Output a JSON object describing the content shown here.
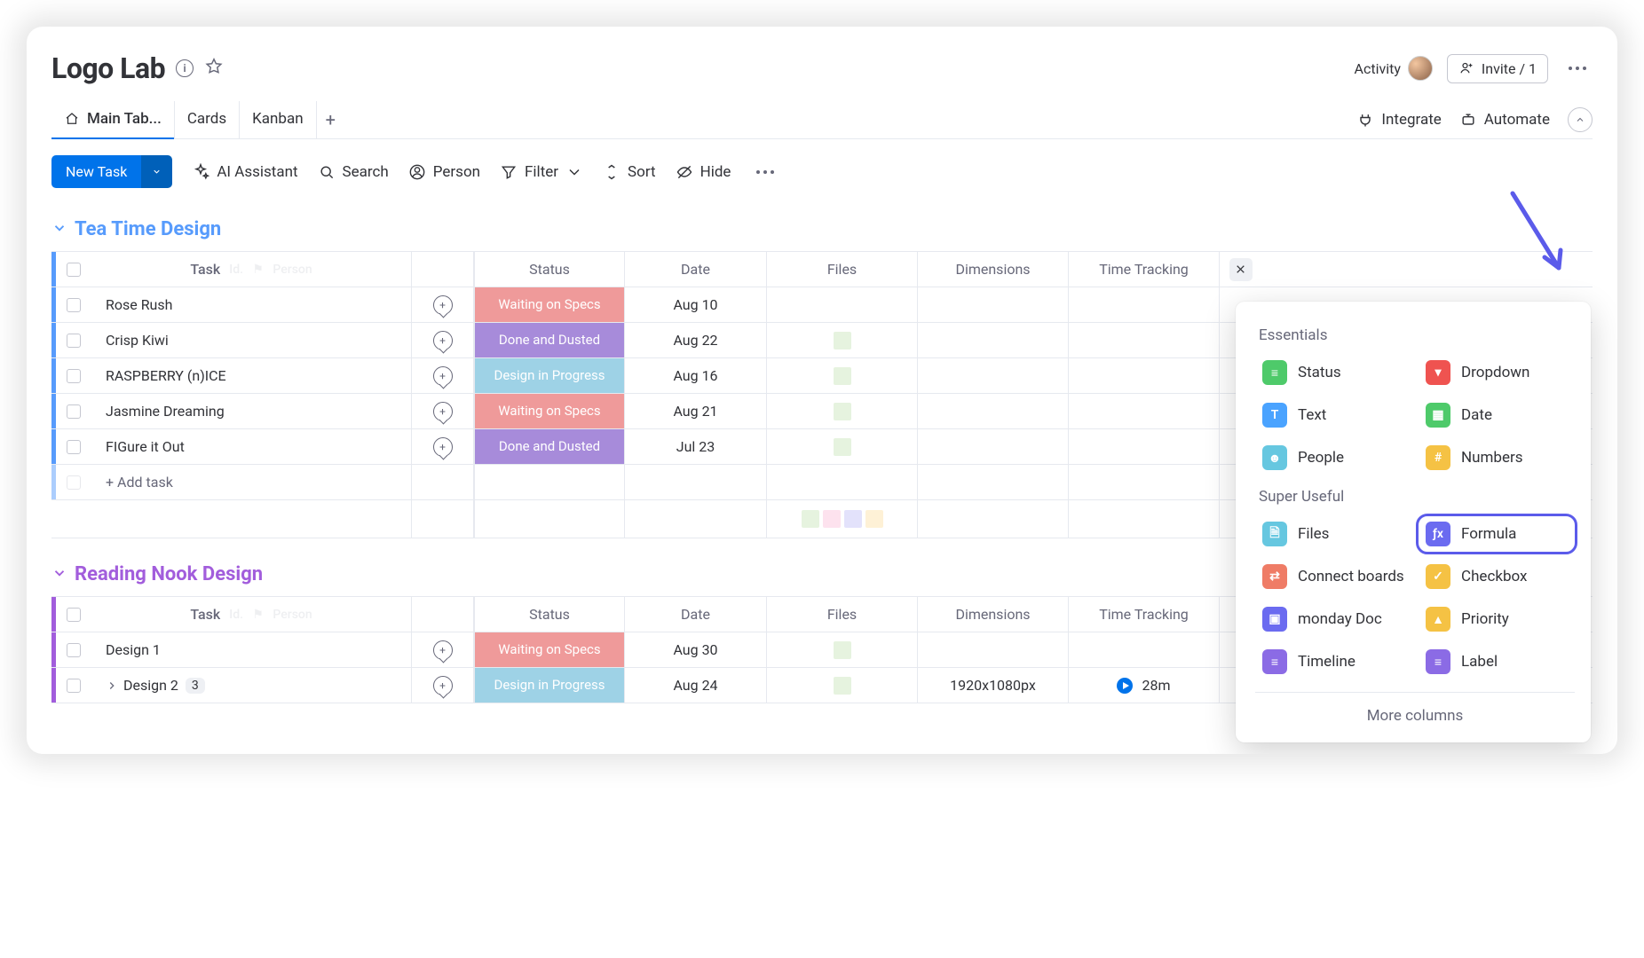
{
  "header": {
    "title": "Logo Lab",
    "activity": "Activity",
    "invite": "Invite / 1"
  },
  "tabs": {
    "main": "Main Tab...",
    "cards": "Cards",
    "kanban": "Kanban",
    "integrate": "Integrate",
    "automate": "Automate"
  },
  "toolbar": {
    "new": "New Task",
    "ai": "AI Assistant",
    "search": "Search",
    "person": "Person",
    "filter": "Filter",
    "sort": "Sort",
    "hide": "Hide"
  },
  "columns": {
    "task": "Task",
    "status": "Status",
    "date": "Date",
    "files": "Files",
    "dimensions": "Dimensions",
    "time_tracking": "Time Tracking"
  },
  "status_colors": {
    "Waiting on Specs": "#ef9a9a",
    "Done and Dusted": "#a78bda",
    "Design in Progress": "#9ed2e6"
  },
  "groups": [
    {
      "id": "g1",
      "title": "Tea Time Design",
      "color": "blue",
      "rows": [
        {
          "task": "Rose Rush",
          "status": "Waiting on Specs",
          "date": "Aug 10",
          "files": 0
        },
        {
          "task": "Crisp Kiwi",
          "status": "Done and Dusted",
          "date": "Aug 22",
          "files": 1
        },
        {
          "task": "RASPBERRY (n)ICE",
          "status": "Design in Progress",
          "date": "Aug 16",
          "files": 1
        },
        {
          "task": "Jasmine Dreaming",
          "status": "Waiting on Specs",
          "date": "Aug 21",
          "files": 1
        },
        {
          "task": "FIGure it Out",
          "status": "Done and Dusted",
          "date": "Jul 23",
          "files": 1
        }
      ],
      "add_text": "+ Add task",
      "summary_files": 4
    },
    {
      "id": "g2",
      "title": "Reading Nook Design",
      "color": "purple",
      "rows": [
        {
          "task": "Design 1",
          "status": "Waiting on Specs",
          "date": "Aug 30",
          "files": 1
        },
        {
          "task": "Design 2",
          "sub": "3",
          "status": "Design in Progress",
          "date": "Aug 24",
          "files": 1,
          "dim": "1920x1080px",
          "tt": "28m"
        }
      ]
    }
  ],
  "popover": {
    "sec1": "Essentials",
    "essentials": [
      {
        "label": "Status",
        "icon_bg": "#4eca6a",
        "glyph": "≡"
      },
      {
        "label": "Dropdown",
        "icon_bg": "#ef5350",
        "glyph": "▾"
      },
      {
        "label": "Text",
        "icon_bg": "#4aa3ff",
        "glyph": "T"
      },
      {
        "label": "Date",
        "icon_bg": "#4eca6a",
        "glyph": "▦"
      },
      {
        "label": "People",
        "icon_bg": "#66c7e0",
        "glyph": "☻"
      },
      {
        "label": "Numbers",
        "icon_bg": "#f5c244",
        "glyph": "#"
      }
    ],
    "sec2": "Super Useful",
    "useful": [
      {
        "label": "Files",
        "icon_bg": "#66c7e0",
        "glyph": "🗎"
      },
      {
        "label": "Formula",
        "icon_bg": "#6b6bf0",
        "glyph": "ƒx",
        "hl": true
      },
      {
        "label": "Connect boards",
        "icon_bg": "#ef7c66",
        "glyph": "⇄"
      },
      {
        "label": "Checkbox",
        "icon_bg": "#f5c244",
        "glyph": "✓"
      },
      {
        "label": "monday Doc",
        "icon_bg": "#6b6bf0",
        "glyph": "▣"
      },
      {
        "label": "Priority",
        "icon_bg": "#f5c244",
        "glyph": "▲"
      },
      {
        "label": "Timeline",
        "icon_bg": "#8b6be5",
        "glyph": "≡"
      },
      {
        "label": "Label",
        "icon_bg": "#8b6be5",
        "glyph": "≡"
      }
    ],
    "more": "More columns"
  }
}
